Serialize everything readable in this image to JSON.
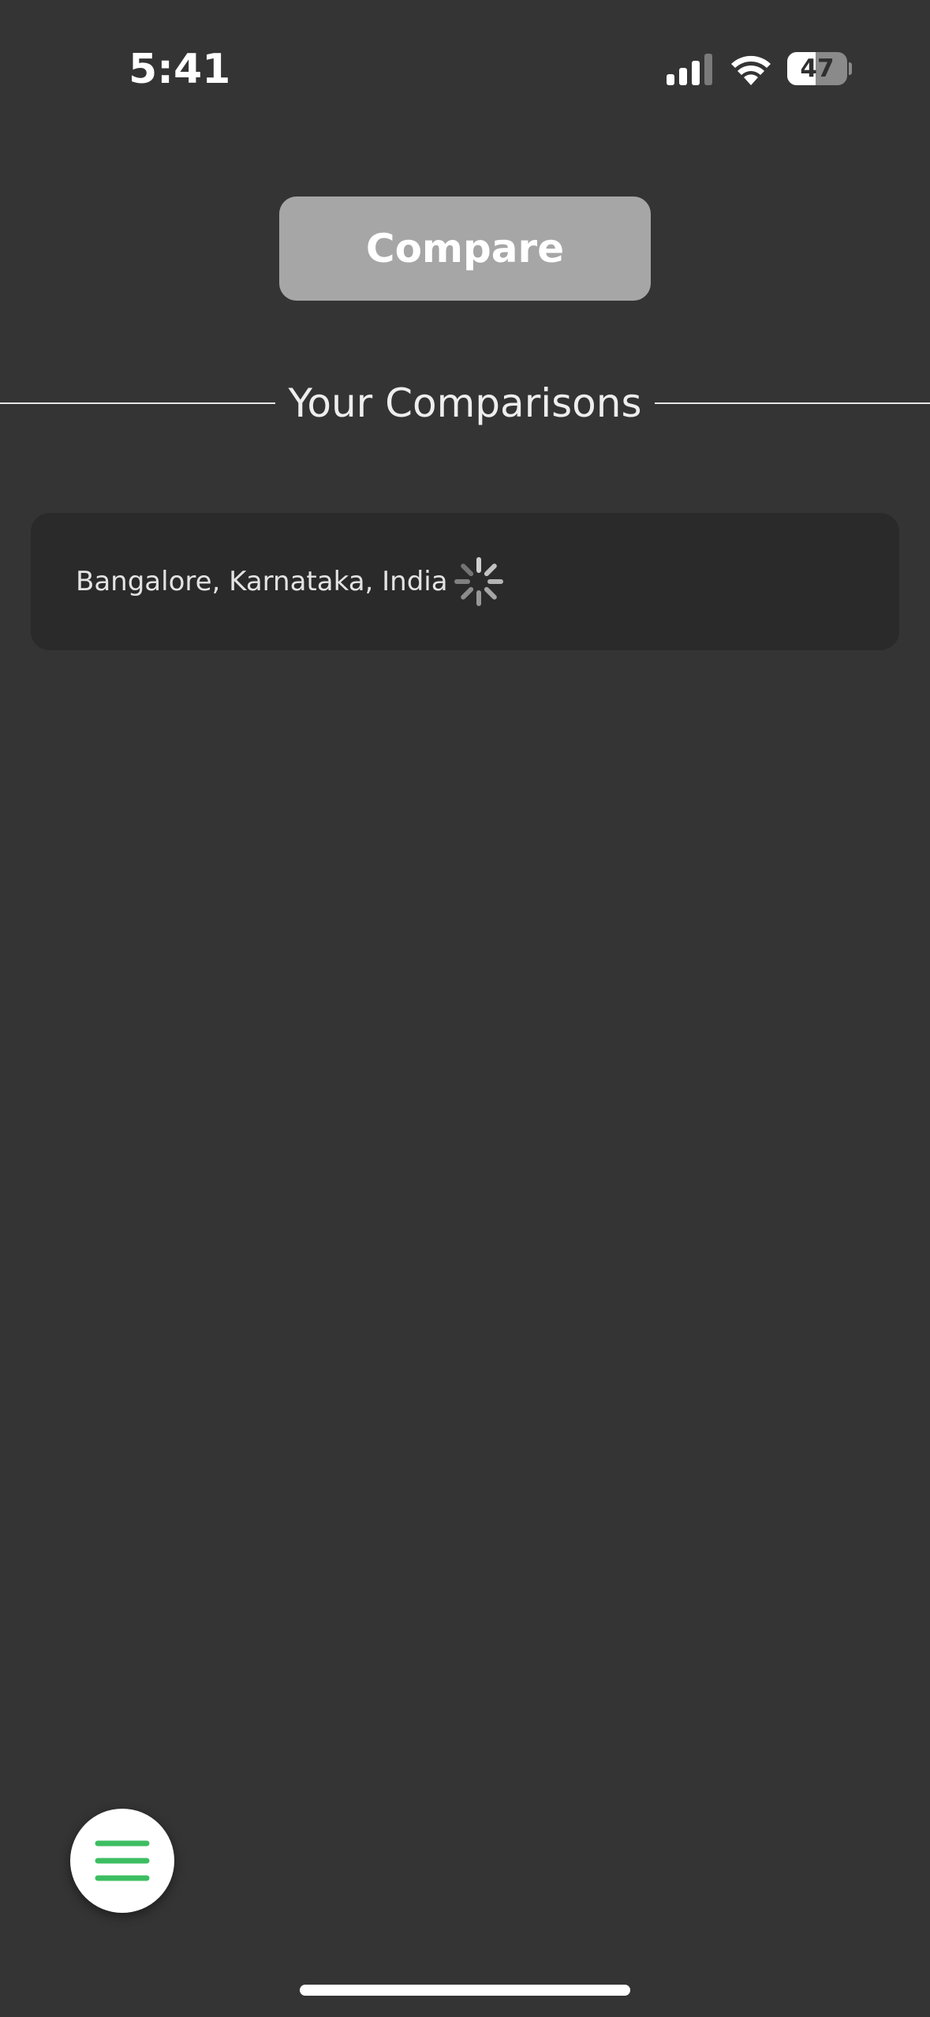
{
  "status_bar": {
    "time": "5:41",
    "battery_level": "47",
    "battery_fraction": 0.47,
    "icons": [
      "signal-icon",
      "wifi-icon",
      "battery-icon"
    ]
  },
  "compare_button": {
    "label": "Compare"
  },
  "section": {
    "title": "Your Comparisons"
  },
  "comparisons": [
    {
      "location": "Bangalore, Karnataka, India",
      "status_icon": "loading-spinner-icon"
    }
  ],
  "menu": {
    "icon": "hamburger-menu-icon",
    "accent_color": "#3dbe62"
  },
  "colors": {
    "background": "#343434",
    "card": "#2a2a2a",
    "button": "#a6a6a6"
  }
}
